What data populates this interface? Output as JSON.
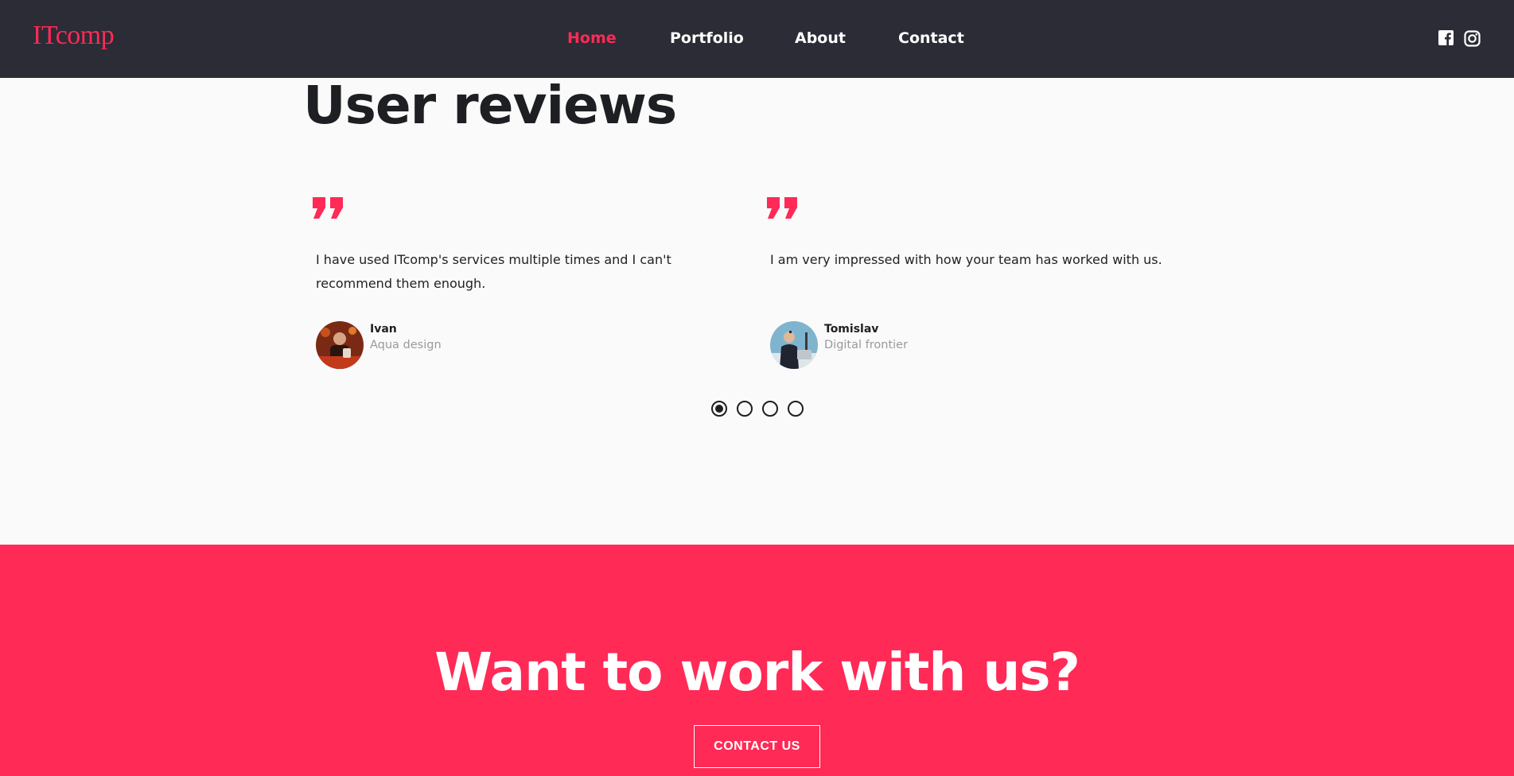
{
  "colors": {
    "nav_bg": "#2b2c36",
    "accent": "#ff2a56",
    "text_dark": "#1e1f22",
    "muted": "#9a9a9a",
    "page_bg": "#fafafa"
  },
  "nav": {
    "logo": "ITcomp",
    "links": [
      {
        "label": "Home",
        "active": true
      },
      {
        "label": "Portfolio",
        "active": false
      },
      {
        "label": "About",
        "active": false
      },
      {
        "label": "Contact",
        "active": false
      }
    ],
    "social_icons": [
      "facebook-icon",
      "instagram-icon"
    ]
  },
  "reviews": {
    "title": "User reviews",
    "items": [
      {
        "quote_icon": "quote-icon",
        "text": "I have used ITcomp's services multiple times and I can't recommend them enough.",
        "name": "Ivan",
        "company": "Aqua design"
      },
      {
        "quote_icon": "quote-icon",
        "text": "I am very impressed with how your team has worked with us.",
        "name": "Tomislav",
        "company": "Digital frontier"
      }
    ],
    "pagination": {
      "total": 4,
      "active": 1
    }
  },
  "cta": {
    "title": "Want to work with us?",
    "button_label": "CONTACT US"
  }
}
